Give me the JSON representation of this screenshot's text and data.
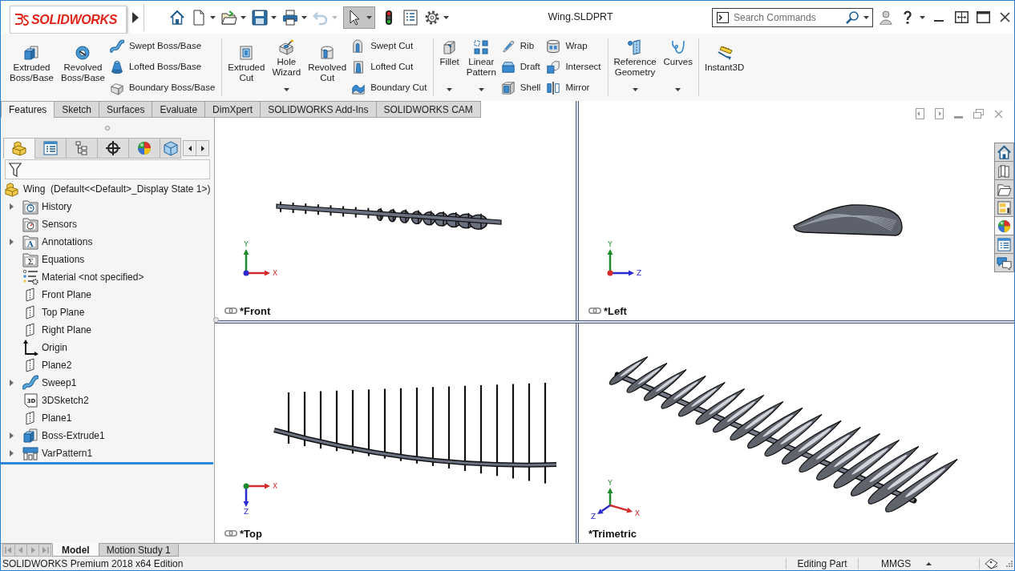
{
  "logo": {
    "text": "SOLIDWORKS"
  },
  "quick_access": [
    {
      "dropdown": false,
      "disabled": false,
      "pressed": false
    },
    {
      "dropdown": true,
      "disabled": false,
      "pressed": false
    },
    {
      "dropdown": true,
      "disabled": false,
      "pressed": false
    },
    {
      "dropdown": true,
      "disabled": false,
      "pressed": false
    },
    {
      "dropdown": true,
      "disabled": false,
      "pressed": false
    },
    {
      "dropdown": true,
      "disabled": true,
      "pressed": false
    },
    {
      "dropdown": true,
      "disabled": false,
      "pressed": true
    },
    {
      "dropdown": false,
      "disabled": false,
      "pressed": false
    },
    {
      "dropdown": false,
      "disabled": false,
      "pressed": false
    },
    {
      "dropdown": true,
      "disabled": false,
      "pressed": false
    }
  ],
  "window": {
    "title": "Wing.SLDPRT"
  },
  "search": {
    "placeholder": "Search Commands"
  },
  "ribbon": {
    "groups": [
      {
        "columns": [
          {
            "kind": "large",
            "label": "Extruded Boss/Base",
            "dropdown": false
          },
          {
            "kind": "large",
            "label": "Revolved Boss/Base",
            "dropdown": false
          },
          {
            "kind": "stack",
            "items": [
              {
                "label": "Swept Boss/Base"
              },
              {
                "label": "Lofted Boss/Base"
              },
              {
                "label": "Boundary Boss/Base"
              }
            ]
          }
        ]
      },
      {
        "columns": [
          {
            "kind": "large",
            "label": "Extruded Cut",
            "dropdown": false
          },
          {
            "kind": "large",
            "label": "Hole Wizard",
            "dropdown": true
          },
          {
            "kind": "large",
            "label": "Revolved Cut",
            "dropdown": false
          },
          {
            "kind": "stack",
            "items": [
              {
                "label": "Swept Cut"
              },
              {
                "label": "Lofted Cut"
              },
              {
                "label": "Boundary Cut"
              }
            ]
          }
        ]
      },
      {
        "columns": [
          {
            "kind": "large",
            "label": "Fillet",
            "dropdown": true
          },
          {
            "kind": "large",
            "label": "Linear Pattern",
            "dropdown": true
          },
          {
            "kind": "stack",
            "items": [
              {
                "label": "Rib"
              },
              {
                "label": "Draft"
              },
              {
                "label": "Shell"
              }
            ]
          },
          {
            "kind": "stack",
            "items": [
              {
                "label": "Wrap"
              },
              {
                "label": "Intersect"
              },
              {
                "label": "Mirror"
              }
            ]
          }
        ]
      },
      {
        "columns": [
          {
            "kind": "large",
            "label": "Reference Geometry",
            "dropdown": true
          },
          {
            "kind": "large",
            "label": "Curves",
            "dropdown": true
          }
        ]
      },
      {
        "columns": [
          {
            "kind": "large",
            "label": "Instant3D",
            "dropdown": false
          }
        ]
      }
    ]
  },
  "command_tabs": [
    {
      "label": "Features",
      "selected": true
    },
    {
      "label": "Sketch",
      "selected": false
    },
    {
      "label": "Surfaces",
      "selected": false
    },
    {
      "label": "Evaluate",
      "selected": false
    },
    {
      "label": "DimXpert",
      "selected": false
    },
    {
      "label": "SOLIDWORKS Add-Ins",
      "selected": false
    },
    {
      "label": "SOLIDWORKS CAM",
      "selected": false
    }
  ],
  "feature_manager": {
    "tabs": [
      {
        "selected": true
      },
      {
        "selected": false
      },
      {
        "selected": false
      },
      {
        "selected": false
      },
      {
        "selected": false
      },
      {
        "selected": false
      }
    ],
    "tree": {
      "root": "Wing  (Default<<Default>_Display State 1>)",
      "items": [
        {
          "label": "History",
          "kind": "history",
          "expandable": true
        },
        {
          "label": "Sensors",
          "kind": "sensors",
          "expandable": false
        },
        {
          "label": "Annotations",
          "kind": "annotations",
          "expandable": true,
          "icon_text": "A"
        },
        {
          "label": "Equations",
          "kind": "equations",
          "expandable": false,
          "icon_text": "Σ"
        },
        {
          "label": "Material <not specified>",
          "kind": "material",
          "expandable": false
        },
        {
          "label": "Front Plane",
          "kind": "plane",
          "expandable": false
        },
        {
          "label": "Top Plane",
          "kind": "plane",
          "expandable": false
        },
        {
          "label": "Right Plane",
          "kind": "plane",
          "expandable": false
        },
        {
          "label": "Origin",
          "kind": "origin",
          "expandable": false
        },
        {
          "label": "Plane2",
          "kind": "plane",
          "expandable": false
        },
        {
          "label": "Sweep1",
          "kind": "sweep",
          "expandable": true
        },
        {
          "label": "3DSketch2",
          "kind": "sketch3d",
          "expandable": false,
          "icon_text": "3D"
        },
        {
          "label": "Plane1",
          "kind": "plane",
          "expandable": false
        },
        {
          "label": "Boss-Extrude1",
          "kind": "extrude",
          "expandable": true
        },
        {
          "label": "VarPattern1",
          "kind": "pattern",
          "expandable": true
        }
      ]
    }
  },
  "views": [
    {
      "label": "*Front",
      "linked": true,
      "kind": "front",
      "origin": {
        "color": "#2a2ad0"
      },
      "axes": [
        {
          "label": "Y",
          "kind": "up",
          "color": "#1e8a2e"
        },
        {
          "label": "X",
          "kind": "right",
          "color": "#d42a2a"
        }
      ]
    },
    {
      "label": "*Left",
      "linked": true,
      "kind": "left",
      "origin": {
        "color": "#d42a2a"
      },
      "axes": [
        {
          "label": "Y",
          "kind": "up",
          "color": "#1e8a2e"
        },
        {
          "label": "Z",
          "kind": "right",
          "color": "#2a2ad0"
        }
      ]
    },
    {
      "label": "*Top",
      "linked": true,
      "kind": "top",
      "origin": {
        "color": "#1e8a2e"
      },
      "axes": [
        {
          "label": "X",
          "kind": "right",
          "color": "#d42a2a"
        },
        {
          "label": "Z",
          "kind": "down",
          "color": "#2a2ad0"
        }
      ]
    },
    {
      "label": "*Trimetric",
      "linked": false,
      "kind": "trimetric",
      "axes": [
        {
          "label": "Y",
          "kind": "up",
          "color": "#1e8a2e"
        },
        {
          "label": "Z",
          "kind": "down-left",
          "color": "#2a2ad0"
        },
        {
          "label": "X",
          "kind": "down-right",
          "color": "#d42a2a"
        }
      ]
    }
  ],
  "task_pane": [
    {
      "selected": false
    },
    {
      "selected": false
    },
    {
      "selected": false
    },
    {
      "selected": false
    },
    {
      "selected": true
    },
    {
      "selected": false
    },
    {
      "selected": false
    }
  ],
  "bottom_tabs": [
    {
      "label": "Model",
      "selected": true
    },
    {
      "label": "Motion Study 1",
      "selected": false
    }
  ],
  "status_bar": {
    "edition": "SOLIDWORKS Premium 2018 x64 Edition",
    "mode": "Editing Part",
    "units": "MMGS"
  }
}
